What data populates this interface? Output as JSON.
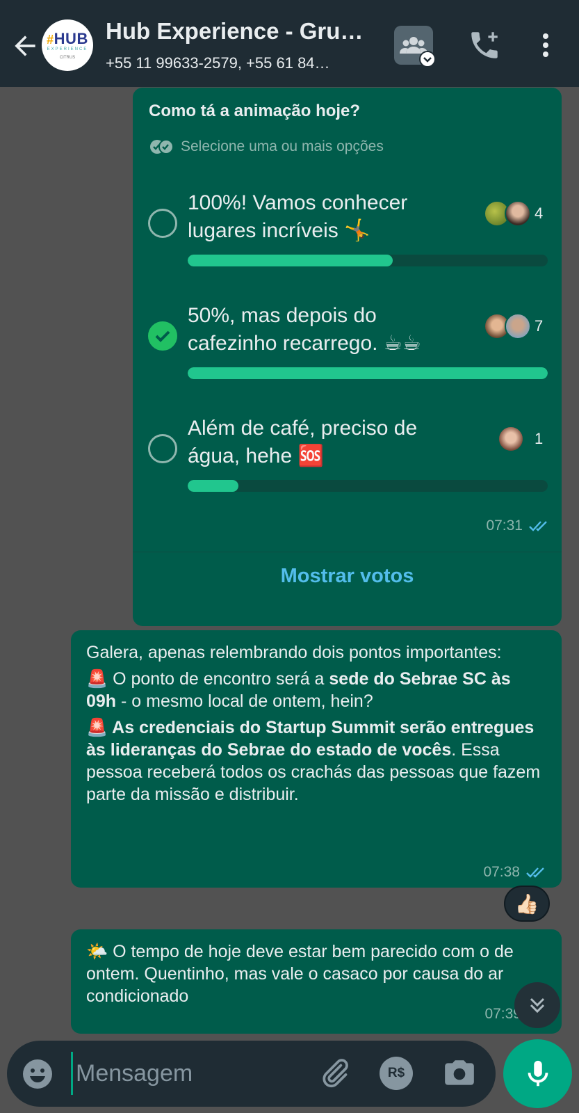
{
  "header": {
    "title": "Hub Experience - Gru…",
    "subtitle": "+55 11 99633-2579, +55 61 84…",
    "avatar": {
      "main": "HUB",
      "tagline": "EXPERIENCE",
      "sub": "CITRUS"
    }
  },
  "poll": {
    "question": "Como tá a animação hoje?",
    "hint": "Selecione uma ou mais opções",
    "options": [
      {
        "text": "100%! Vamos conhecer lugares incríveis 🤸",
        "votes": "4",
        "fraction": 0.57,
        "checked": false
      },
      {
        "text": "50%, mas depois do cafezinho recarrego. ☕☕",
        "votes": "7",
        "fraction": 1.0,
        "checked": true
      },
      {
        "text": "Além de café, preciso de água, hehe 🆘",
        "votes": "1",
        "fraction": 0.14,
        "checked": false
      }
    ],
    "time": "07:31",
    "show_votes": "Mostrar votos"
  },
  "message1": {
    "intro": "Galera, apenas relembrando dois pontos importantes:",
    "p1_emoji": "🚨",
    "p1_text_a": " O ponto de encontro será a ",
    "p1_bold": "sede do Sebrae SC às 09h",
    "p1_text_b": " - o mesmo local de ontem, hein?",
    "p2_emoji": "🚨",
    "p2_bold": " As credenciais do Startup Summit serão entregues às lideranças do Sebrae do estado de vocês",
    "p2_text": ". Essa pessoa receberá todos os crachás das pessoas que fazem parte da missão e distribuir.",
    "time": "07:38",
    "reaction": "👍🏻"
  },
  "message2": {
    "emoji": "🌤️",
    "text": " O tempo de hoje deve estar bem parecido com o de ontem. Quentinho, mas vale o casaco por causa do ar condicionado",
    "time": "07:39"
  },
  "composer": {
    "placeholder": "Mensagem",
    "pay_label": "R$"
  },
  "colors": {
    "header_bg": "#1f2c34",
    "bubble_out": "#005c4b",
    "accent": "#00a884",
    "poll_bar": "#21c68e",
    "link": "#53bdeb",
    "read_ticks": "#53bdeb"
  },
  "icons": [
    "arrow-left-icon",
    "community-icon",
    "add-call-icon",
    "more-vert-icon",
    "double-check-icon",
    "emoji-icon",
    "attach-icon",
    "camera-icon",
    "mic-icon",
    "chevron-double-down-icon"
  ]
}
